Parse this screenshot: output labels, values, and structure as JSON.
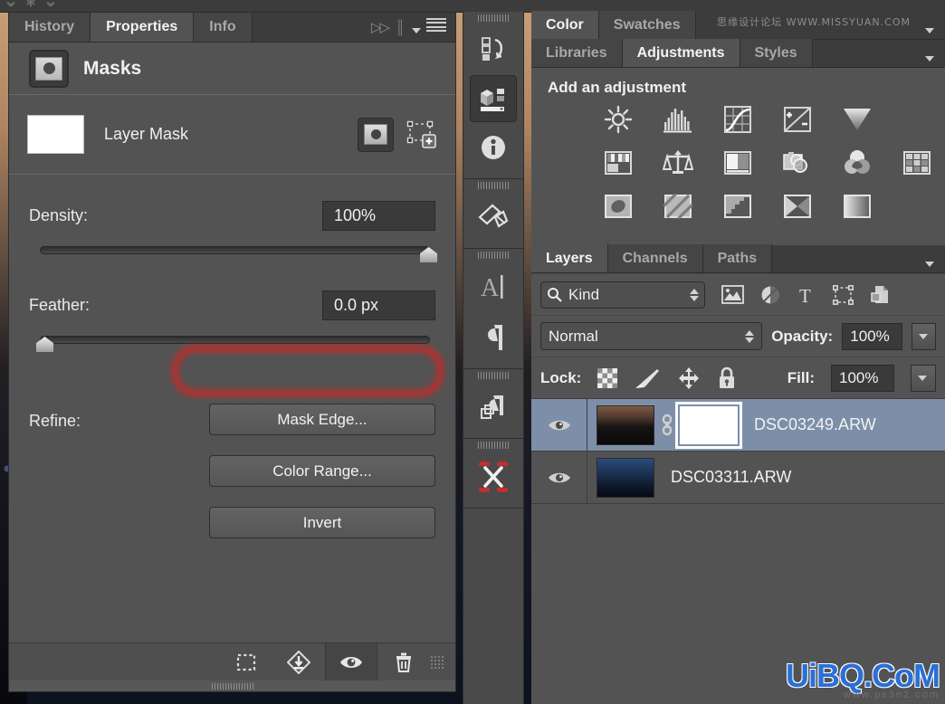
{
  "app": {
    "watermark_cn": "思缘设计论坛 WWW.MISSYUAN.COM",
    "watermark_brand": "UiBQ.CoM",
    "watermark_brand_sub": "www.ps3n2.com"
  },
  "properties_panel": {
    "tabs": [
      {
        "label": "History",
        "active": false
      },
      {
        "label": "Properties",
        "active": true
      },
      {
        "label": "Info",
        "active": false
      }
    ],
    "title": "Masks",
    "mask_row": {
      "label": "Layer Mask"
    },
    "density": {
      "label": "Density:",
      "value": "100%",
      "slider_percent": 100
    },
    "feather": {
      "label": "Feather:",
      "value": "0.0 px",
      "slider_percent": 0
    },
    "refine": {
      "label": "Refine:",
      "buttons": [
        {
          "label": "Mask Edge...",
          "highlighted": false
        },
        {
          "label": "Color Range...",
          "highlighted": true
        },
        {
          "label": "Invert",
          "highlighted": false
        }
      ]
    },
    "footer_icons": [
      "selection-from-mask-icon",
      "apply-mask-icon",
      "toggle-mask-visibility-icon",
      "delete-mask-icon"
    ]
  },
  "icon_dock": {
    "groups": [
      {
        "items": [
          "history-icon",
          "properties-icon",
          "info-icon"
        ]
      },
      {
        "items": [
          "adjustments-icon"
        ]
      },
      {
        "items": [
          "character-icon",
          "paragraph-icon"
        ]
      },
      {
        "items": [
          "paragraph-styles-icon"
        ]
      },
      {
        "items": [
          "clone-source-icon"
        ]
      }
    ]
  },
  "color_panel": {
    "tabs": [
      {
        "label": "Color",
        "active": true
      },
      {
        "label": "Swatches",
        "active": false
      }
    ]
  },
  "adjustments_panel": {
    "tabs": [
      {
        "label": "Libraries",
        "active": false
      },
      {
        "label": "Adjustments",
        "active": true
      },
      {
        "label": "Styles",
        "active": false
      }
    ],
    "heading": "Add an adjustment",
    "rows": [
      [
        "brightness-contrast-icon",
        "levels-icon",
        "curves-icon",
        "exposure-icon",
        "vibrance-icon"
      ],
      [
        "hue-saturation-icon",
        "color-balance-icon",
        "black-white-icon",
        "photo-filter-icon",
        "channel-mixer-icon",
        "color-lookup-icon"
      ],
      [
        "invert-icon",
        "posterize-icon",
        "threshold-icon",
        "gradient-map-icon",
        "selective-color-icon"
      ]
    ]
  },
  "layers_panel": {
    "tabs": [
      {
        "label": "Layers",
        "active": true
      },
      {
        "label": "Channels",
        "active": false
      },
      {
        "label": "Paths",
        "active": false
      }
    ],
    "filter": {
      "kind_label": "Kind",
      "icons": [
        "pixel-layer-filter-icon",
        "adjustment-layer-filter-icon",
        "type-layer-filter-icon",
        "shape-layer-filter-icon",
        "smart-object-filter-icon"
      ]
    },
    "blend_mode": "Normal",
    "opacity": {
      "label": "Opacity:",
      "value": "100%"
    },
    "fill": {
      "label": "Fill:",
      "value": "100%"
    },
    "lock": {
      "label": "Lock:",
      "icons": [
        "lock-transparency-icon",
        "lock-image-pixels-icon",
        "lock-position-icon",
        "lock-all-icon"
      ]
    },
    "layers": [
      {
        "name": "DSC03249.ARW",
        "selected": true,
        "visible": true,
        "has_mask": true,
        "linked": true
      },
      {
        "name": "DSC03311.ARW",
        "selected": false,
        "visible": true,
        "has_mask": false,
        "linked": false
      }
    ]
  },
  "colors": {
    "panel_bg": "#535353",
    "tab_bg": "#454545",
    "dark_bg": "#3a3a3a",
    "highlight_ring": "#e22020",
    "layer_selected": "#7d8fa8",
    "brand_blue": "#2a6fd6"
  }
}
